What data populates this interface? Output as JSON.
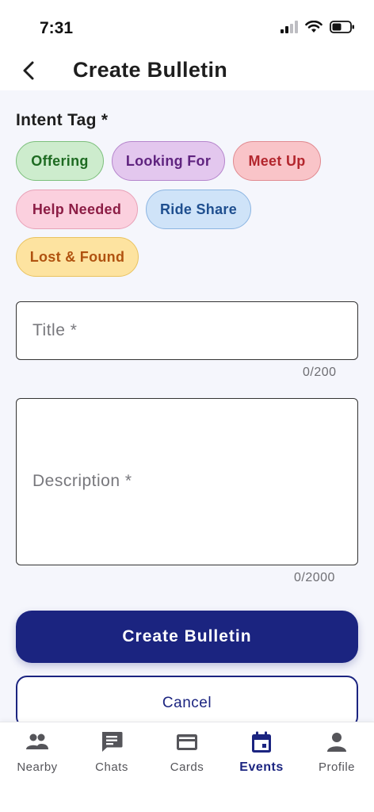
{
  "status_bar": {
    "time": "7:31"
  },
  "header": {
    "title": "Create Bulletin"
  },
  "form": {
    "intent_label": "Intent Tag *",
    "tags": [
      {
        "label": "Offering",
        "bg": "#cdeccd",
        "border": "#7cbf7c",
        "text": "#1e6b22"
      },
      {
        "label": "Looking For",
        "bg": "#e3c7ee",
        "border": "#b585cc",
        "text": "#5f237f"
      },
      {
        "label": "Meet Up",
        "bg": "#f9c4c8",
        "border": "#e08a90",
        "text": "#b3262d"
      },
      {
        "label": "Help Needed",
        "bg": "#fbd0de",
        "border": "#e8a1b7",
        "text": "#8c1d45"
      },
      {
        "label": "Ride Share",
        "bg": "#cfe3f8",
        "border": "#8cb5e2",
        "text": "#1f4f8f"
      },
      {
        "label": "Lost & Found",
        "bg": "#fde3a0",
        "border": "#e9c360",
        "text": "#b0520f"
      }
    ],
    "title_placeholder": "Title *",
    "title_counter": "0/200",
    "description_placeholder": "Description *",
    "description_counter": "0/2000",
    "create_label": "Create Bulletin",
    "cancel_label": "Cancel"
  },
  "nav": {
    "items": [
      {
        "label": "Nearby",
        "icon": "people-icon"
      },
      {
        "label": "Chats",
        "icon": "chat-icon"
      },
      {
        "label": "Cards",
        "icon": "card-icon"
      },
      {
        "label": "Events",
        "icon": "calendar-icon"
      },
      {
        "label": "Profile",
        "icon": "person-icon"
      }
    ],
    "active": "Events"
  },
  "colors": {
    "primary": "#1b2480",
    "background": "#f5f6fc"
  }
}
